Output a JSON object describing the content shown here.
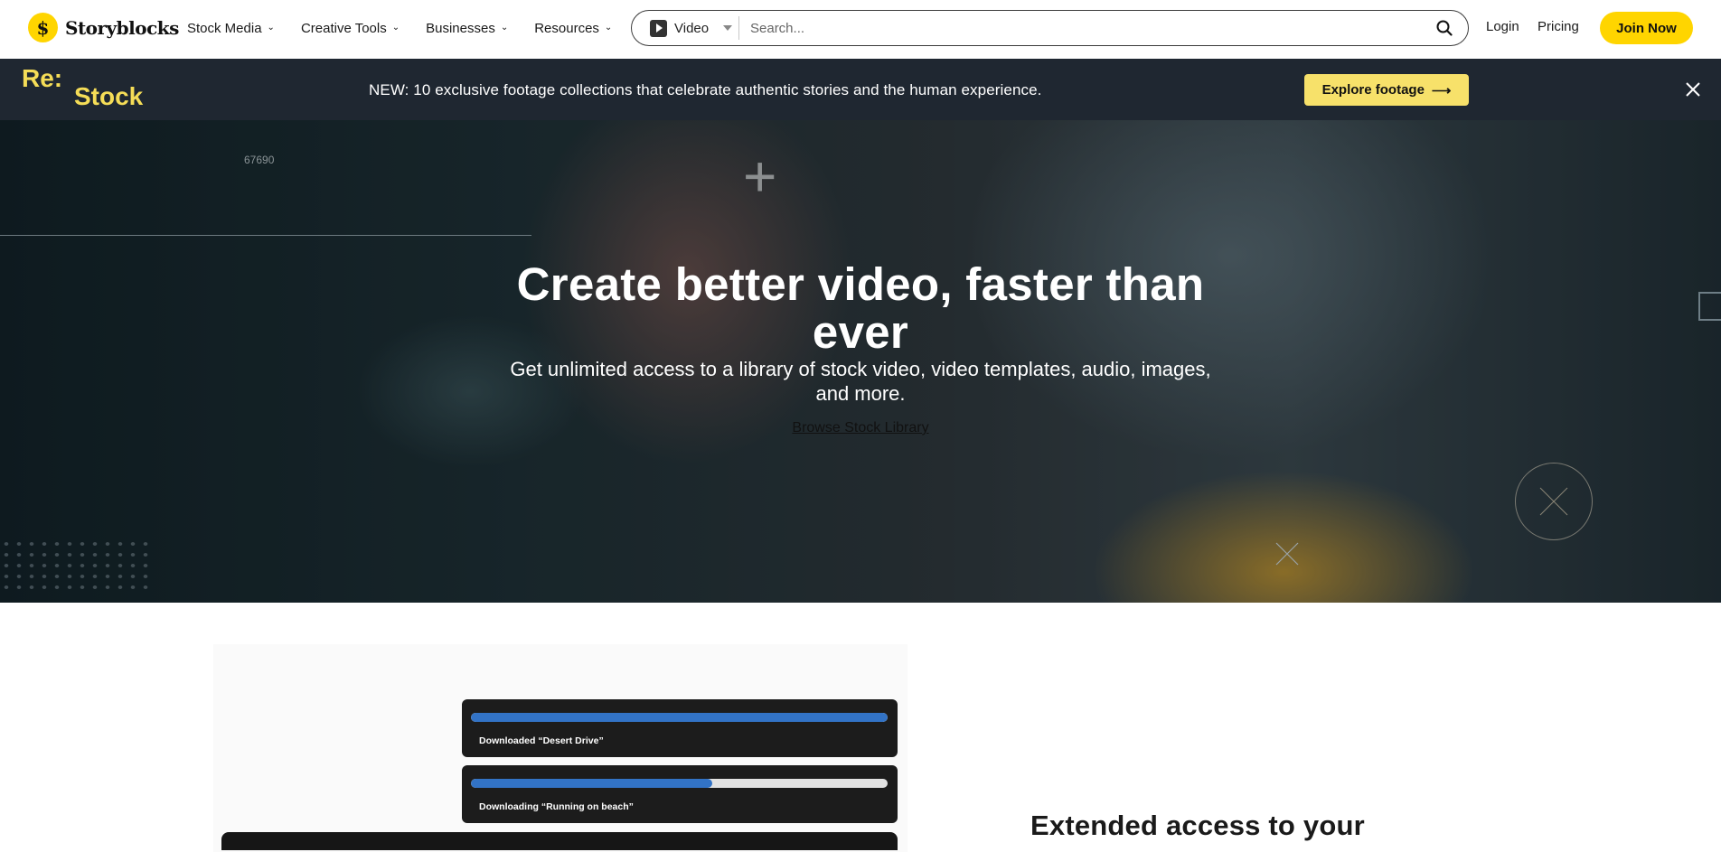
{
  "brand": {
    "name": "Storyblocks",
    "logo_glyph": "$",
    "accent": "#ffd500"
  },
  "nav": {
    "items": [
      {
        "label": "Stock Media"
      },
      {
        "label": "Creative Tools"
      },
      {
        "label": "Businesses"
      },
      {
        "label": "Resources"
      }
    ],
    "search": {
      "type_label": "Video",
      "placeholder": "Search..."
    },
    "login_label": "Login",
    "pricing_label": "Pricing",
    "join_label": "Join Now"
  },
  "banner": {
    "logo_re": "Re:",
    "logo_stock": "Stock",
    "text": "NEW: 10 exclusive footage collections that celebrate authentic stories and the human experience.",
    "cta_label": "Explore footage",
    "cta_arrow": "⟶",
    "accent": "#f5dd57",
    "background": "#1f2731"
  },
  "hero": {
    "counter": "67690",
    "title": "Create better video, faster than ever",
    "subtitle": "Get unlimited access to a library of stock video, video templates, audio, images, and more.",
    "link_label": "Browse Stock Library"
  },
  "demo": {
    "downloads": [
      {
        "label": "Downloaded “Desert Drive”",
        "progress": 1.0
      },
      {
        "label": "Downloading “Running on beach”",
        "progress": 0.58
      }
    ],
    "progress_color": "#3273c6"
  },
  "section": {
    "heading": "Extended access to your"
  }
}
